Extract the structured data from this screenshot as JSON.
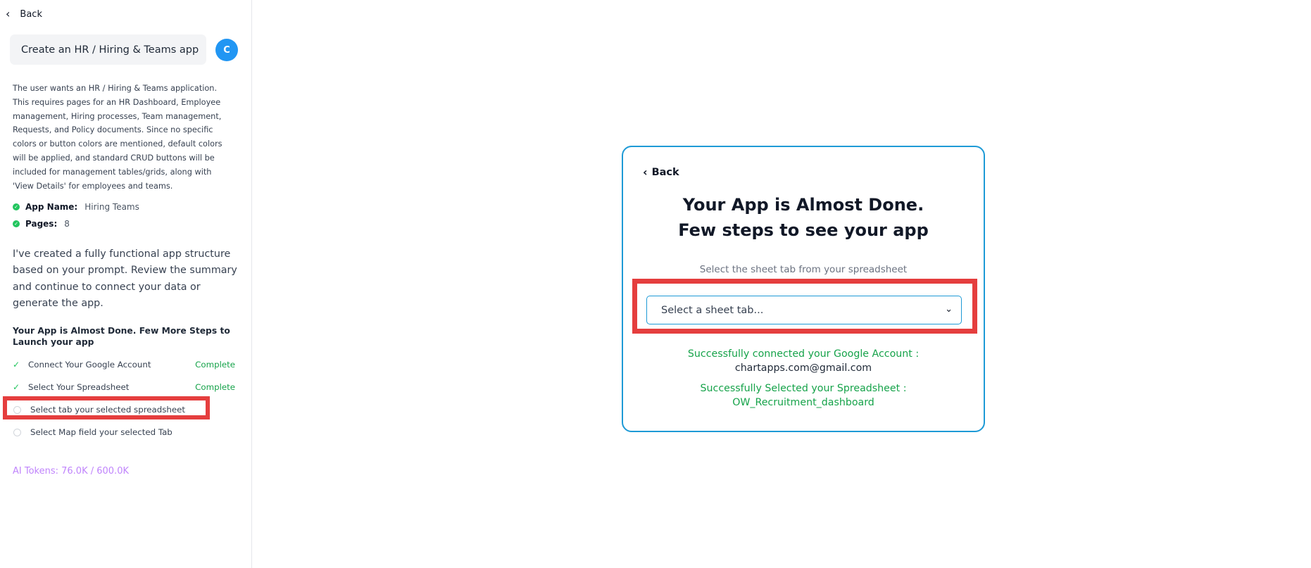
{
  "sidebar": {
    "back_label": "Back",
    "prompt": "Create an HR / Hiring & Teams app",
    "avatar_initial": "C",
    "summary": "The user wants an HR / Hiring & Teams application. This requires pages for an HR Dashboard, Employee management, Hiring processes, Team management, Requests, and Policy documents. Since no specific colors or button colors are mentioned, default colors will be applied, and standard CRUD buttons will be included for management tables/grids, along with 'View Details' for employees and teams.",
    "app_name_key": "App Name:",
    "app_name_value": "Hiring Teams",
    "pages_key": "Pages:",
    "pages_value": "8",
    "created_message": "I've created a fully functional app structure based on your prompt. Review the summary and continue to connect your data or generate the app.",
    "steps_title": "Your App is Almost Done. Few More Steps to Launch your app",
    "steps": [
      {
        "label": "Connect Your Google Account",
        "status": "Complete"
      },
      {
        "label": "Select Your Spreadsheet",
        "status": "Complete"
      },
      {
        "label": "Select tab your selected spreadsheet",
        "status": ""
      },
      {
        "label": "Select Map field your selected Tab",
        "status": ""
      }
    ],
    "tokens": "AI Tokens: 76.0K / 600.0K"
  },
  "card": {
    "back_label": "Back",
    "title_line1": "Your App is Almost Done.",
    "title_line2": "Few steps to see your app",
    "select_label": "Select the sheet tab from your spreadsheet",
    "select_placeholder": "Select a sheet tab...",
    "google_connected": "Successfully connected your Google Account :",
    "google_email": "chartapps.com@gmail.com",
    "spreadsheet_selected": "Successfully Selected your Spreadsheet :",
    "spreadsheet_name": "OW_Recruitment_dashboard"
  },
  "colors": {
    "accent": "#1e9ad6",
    "highlight": "#e53e3e",
    "success": "#16a34a",
    "tokens": "#c084fc",
    "avatar": "#2196f3"
  }
}
